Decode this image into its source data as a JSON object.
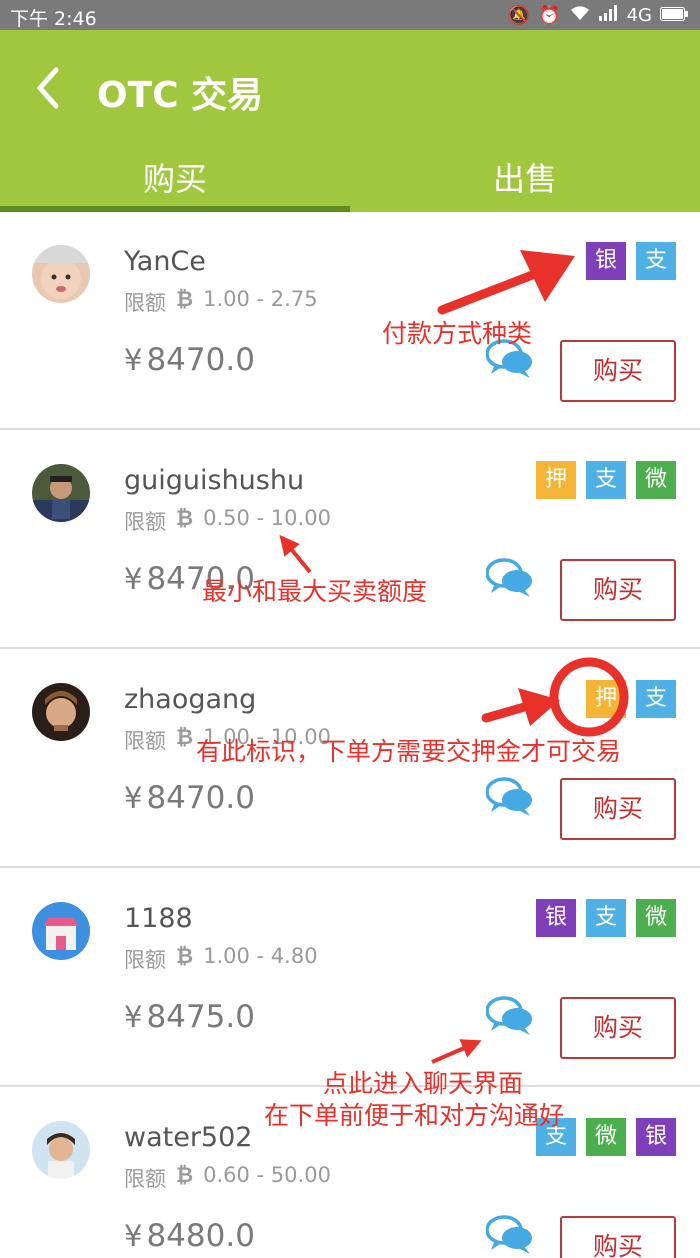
{
  "status": {
    "time": "下午 2:46",
    "network": "4G",
    "icons": [
      "mute-icon",
      "alarm-icon",
      "wifi-icon",
      "signal-icon",
      "battery-icon"
    ]
  },
  "header": {
    "title": "OTC 交易",
    "tabs": [
      {
        "label": "购买",
        "active": true
      },
      {
        "label": "出售",
        "active": false
      }
    ],
    "color": "#a0c73d"
  },
  "common": {
    "limit_label": "限额",
    "btc_symbol": "₿",
    "currency": "¥",
    "buy_label": "购买"
  },
  "tag_labels": {
    "yin": "银",
    "zhi": "支",
    "wei": "微",
    "ya": "押"
  },
  "tag_colors": {
    "yin": "#7e3fb8",
    "zhi": "#4fb0e6",
    "wei": "#4cae4f",
    "ya": "#f4b536"
  },
  "offers": [
    {
      "user": "YanCe",
      "limit": "1.00 - 2.75",
      "price": "8470.0",
      "tags": [
        "银",
        "支"
      ]
    },
    {
      "user": "guiguishushu",
      "limit": "0.50 - 10.00",
      "price": "8470.0",
      "tags": [
        "押",
        "支",
        "微"
      ]
    },
    {
      "user": "zhaogang",
      "limit": "1.00 - 10.00",
      "price": "8470.0",
      "tags": [
        "押",
        "支"
      ]
    },
    {
      "user": "1188",
      "limit": "1.00 - 4.80",
      "price": "8475.0",
      "tags": [
        "银",
        "支",
        "微"
      ]
    },
    {
      "user": "water502",
      "limit": "0.60 - 50.00",
      "price": "8480.0",
      "tags": [
        "支",
        "微",
        "银"
      ]
    }
  ],
  "annotations": {
    "payment_types": "付款方式种类",
    "limits": "最小和最大买卖额度",
    "deposit": "有此标识，下单方需要交押金才可交易",
    "chat_line1": "点此进入聊天界面",
    "chat_line2": "在下单前便于和对方沟通好"
  }
}
